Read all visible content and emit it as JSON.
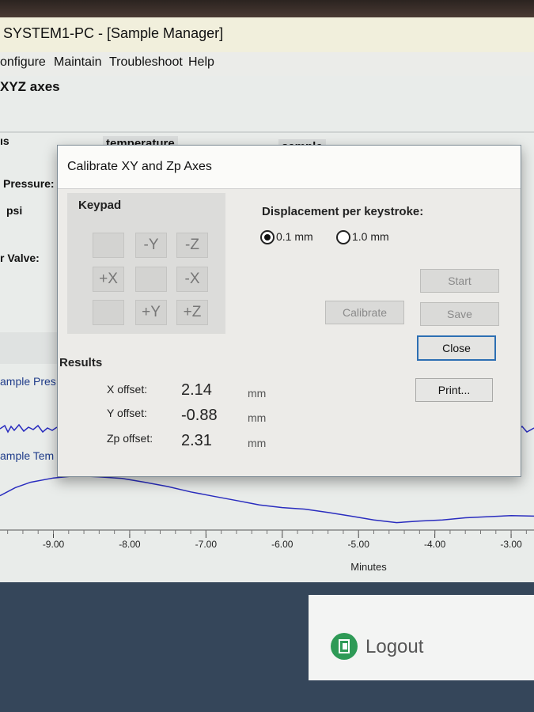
{
  "window": {
    "title": "SYSTEM1-PC - [Sample Manager]"
  },
  "menu": {
    "items": [
      "onfigure",
      "Maintain",
      "Troubleshoot",
      "Help"
    ]
  },
  "subheader": "XYZ axes",
  "background": {
    "col_headers": [
      "ıs",
      "temperature",
      "sample"
    ],
    "labels": [
      "Pressure:",
      "psi",
      "r Valve:",
      "ample Pres",
      "ample Tem"
    ]
  },
  "dialog": {
    "title": "Calibrate XY and Zp Axes",
    "keypad": {
      "label": "Keypad",
      "buttons": [
        "",
        "-Y",
        "-Z",
        "+X",
        "",
        "-X",
        "",
        "+Y",
        "+Z"
      ]
    },
    "displacement": {
      "label": "Displacement per keystroke:",
      "options": [
        "0.1 mm",
        "1.0 mm"
      ],
      "selected": "0.1 mm"
    },
    "buttons": {
      "start": "Start",
      "calibrate": "Calibrate",
      "save": "Save",
      "close": "Close",
      "print": "Print..."
    },
    "results": {
      "label": "Results",
      "rows": [
        {
          "label": "X offset:",
          "value": "2.14",
          "unit": "mm"
        },
        {
          "label": "Y offset:",
          "value": "-0.88",
          "unit": "mm"
        },
        {
          "label": "Zp offset:",
          "value": "2.31",
          "unit": "mm"
        }
      ]
    }
  },
  "chart_data": {
    "type": "line",
    "xlabel": "Minutes",
    "xlim": [
      -9.7,
      -2.7
    ],
    "x_ticks": [
      "-9.00",
      "-8.00",
      "-7.00",
      "-6.00",
      "-5.00",
      "-4.00",
      "-3.00"
    ],
    "series": [
      {
        "x": [
          -9.7,
          -9.5,
          -9.3,
          -9.0,
          -8.7,
          -8.4,
          -8.1,
          -7.8,
          -7.5,
          -7.2,
          -6.9,
          -6.6,
          -6.3,
          -6.0,
          -5.7,
          -5.4,
          -5.1,
          -4.8,
          -4.5,
          -4.2,
          -3.9,
          -3.6,
          -3.3,
          -3.0,
          -2.7
        ],
        "y": [
          0.55,
          0.7,
          0.8,
          0.88,
          0.92,
          0.9,
          0.87,
          0.8,
          0.72,
          0.62,
          0.54,
          0.46,
          0.38,
          0.33,
          0.3,
          0.24,
          0.17,
          0.1,
          0.05,
          0.08,
          0.1,
          0.14,
          0.16,
          0.18,
          0.17
        ],
        "color": "#2a2dbf"
      }
    ]
  },
  "logout": {
    "label": "Logout"
  },
  "colors": {
    "accent": "#2d6fb3",
    "logout_green": "#2e9a56",
    "trace": "#2a2dbf"
  }
}
